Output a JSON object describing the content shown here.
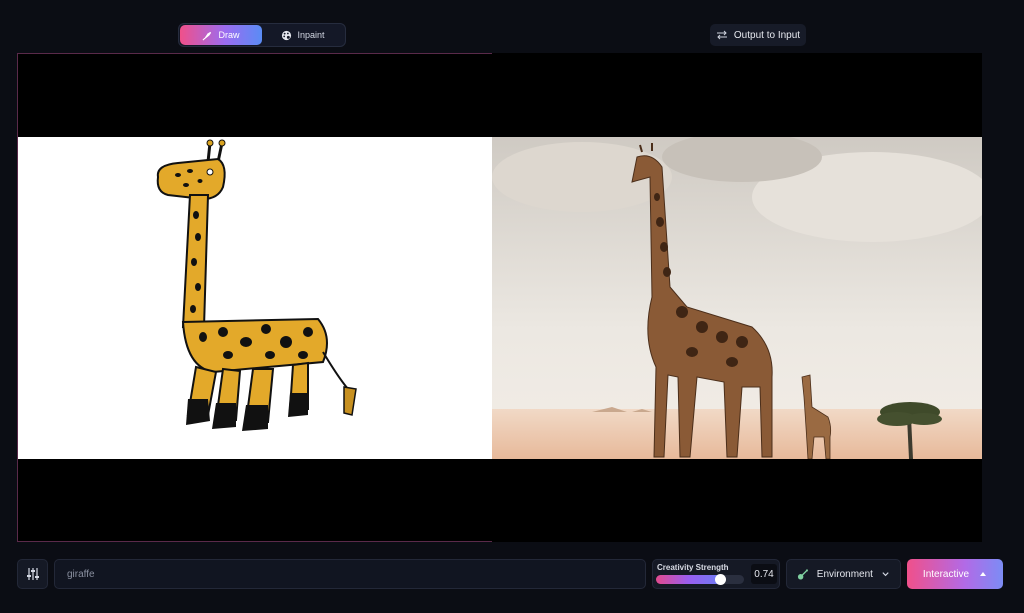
{
  "mode_toggle": {
    "draw_label": "Draw",
    "inpaint_label": "Inpaint",
    "active": "Draw"
  },
  "output_to_input_label": "Output to Input",
  "prompt": {
    "value": "giraffe"
  },
  "creativity": {
    "label": "Creativity Strength",
    "value": "0.74",
    "level": 0.74
  },
  "environment": {
    "label": "Environment"
  },
  "interactive_button": {
    "label": "Interactive"
  },
  "colors": {
    "accent_gradient_start": "#f0508a",
    "accent_gradient_end": "#5a8cf5",
    "background": "#0b0d14"
  }
}
